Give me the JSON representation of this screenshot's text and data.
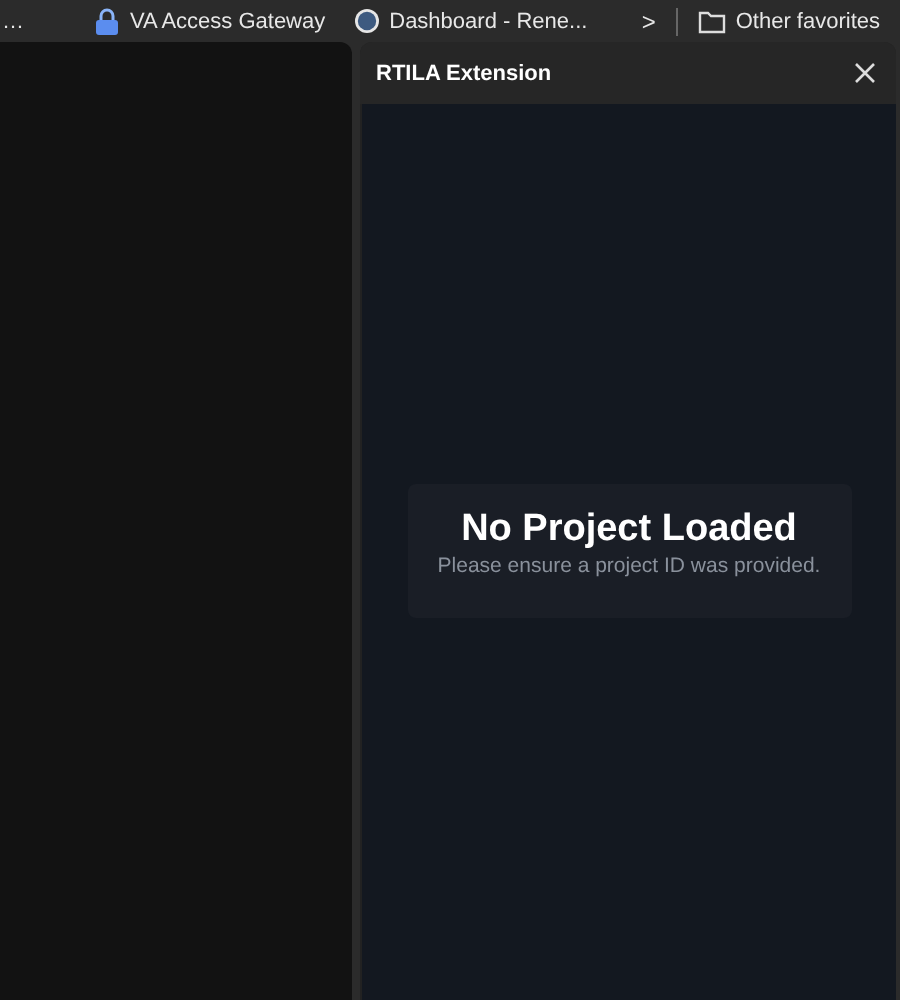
{
  "bookmarks_bar": {
    "items": [
      {
        "label": "…",
        "kind": "plain"
      },
      {
        "label": "VA Access Gateway",
        "kind": "lock"
      },
      {
        "label": "Dashboard - Rene...",
        "kind": "wp"
      }
    ],
    "more": ">",
    "other": {
      "label": "Other favorites"
    }
  },
  "panel": {
    "title": "RTILA Extension",
    "message": {
      "title": "No Project Loaded",
      "text": "Please ensure a project ID was provided."
    }
  }
}
